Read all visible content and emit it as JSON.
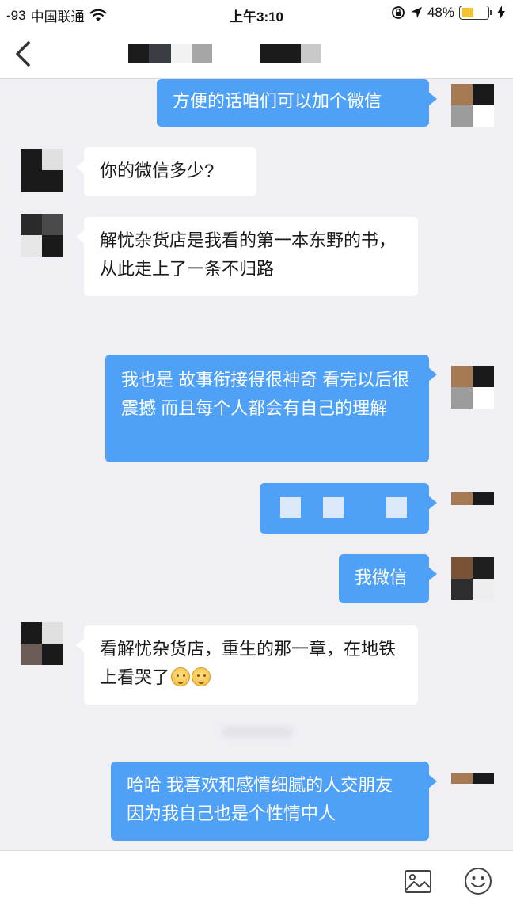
{
  "status_bar": {
    "signal": "-93",
    "carrier": "中国联通",
    "time": "上午3:10",
    "battery_text": "48%",
    "battery_level": 0.48,
    "icons": [
      "wifi-icon",
      "rotation-lock-icon",
      "location-arrow-icon",
      "battery-icon",
      "charging-bolt-icon"
    ]
  },
  "nav": {
    "back_icon": "chevron-left-icon"
  },
  "messages": [
    {
      "side": "out",
      "text": "方便的话咱们可以加个微信"
    },
    {
      "side": "in",
      "text": "你的微信多少?"
    },
    {
      "side": "in",
      "text": "解忧杂货店是我看的第一本东野的书，从此走上了一条不归路"
    },
    {
      "side": "out",
      "text": "我也是 故事衔接得很神奇 看完以后很震撼 而且每个人都会有自己的理解"
    },
    {
      "side": "out",
      "text": ""
    },
    {
      "side": "out",
      "text": "我微信"
    },
    {
      "side": "in",
      "text": "看解忧杂货店，重生的那一章，在地铁上看哭了"
    },
    {
      "side": "out",
      "text": "哈哈 我喜欢和感情细腻的人交朋友 因为我自己也是个性情中人"
    }
  ],
  "bottom_bar": {
    "image_icon": "image-icon",
    "emoji_icon": "smiley-icon"
  },
  "colors": {
    "outgoing_bubble": "#4ea1f7",
    "incoming_bubble": "#ffffff",
    "chat_background": "#efeff4"
  }
}
